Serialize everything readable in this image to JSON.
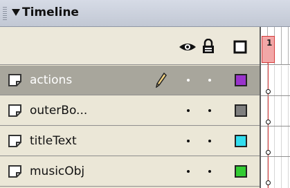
{
  "panel": {
    "title": "Timeline"
  },
  "header_icons": [
    "eye-icon",
    "lock-icon",
    "outline-icon"
  ],
  "layers": [
    {
      "name": "actions",
      "selected": true,
      "color": "#9933cc",
      "pencil": true
    },
    {
      "name": "outerBo...",
      "selected": false,
      "color": "#7f7f7f",
      "pencil": false
    },
    {
      "name": "titleText",
      "selected": false,
      "color": "#33ddee",
      "pencil": false
    },
    {
      "name": "musicObj",
      "selected": false,
      "color": "#33cc33",
      "pencil": false
    }
  ],
  "frames": {
    "current_frame": "1"
  }
}
